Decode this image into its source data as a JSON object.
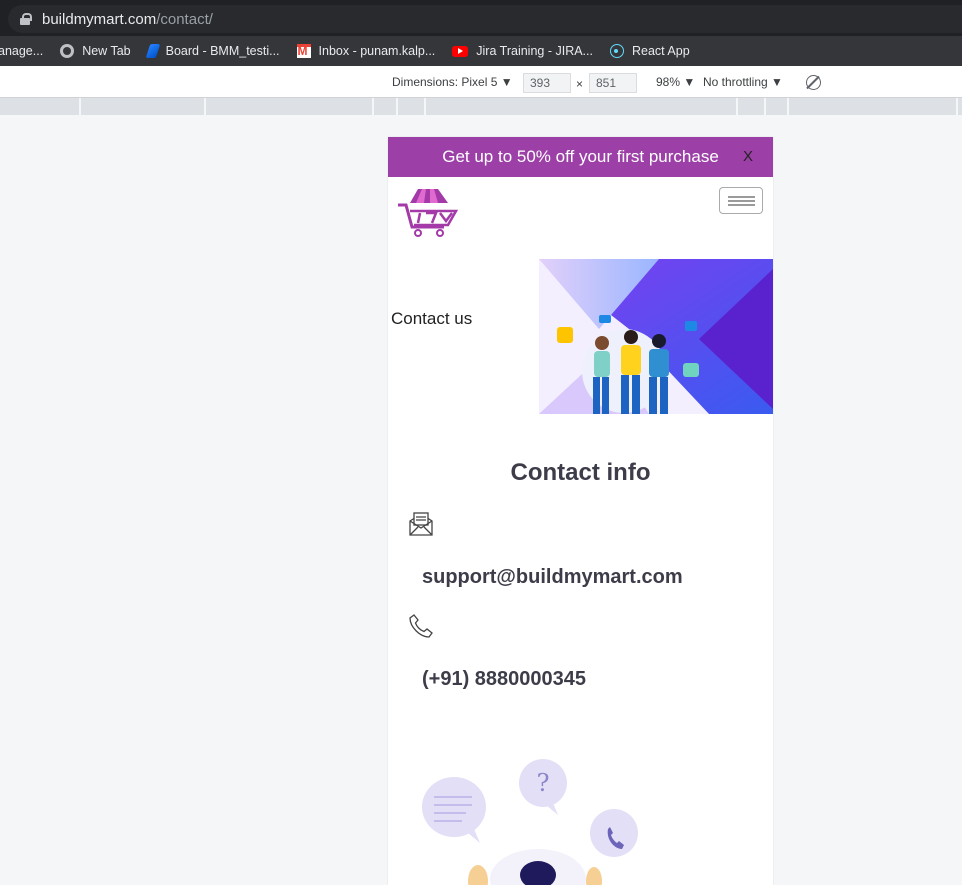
{
  "browser": {
    "url_domain": "buildmymart.com",
    "url_path": "/contact/",
    "bookmarks": [
      {
        "label": "anage...",
        "icon": "none"
      },
      {
        "label": "New Tab",
        "icon": "globe-icon"
      },
      {
        "label": "Board - BMM_testi...",
        "icon": "jira-board-icon"
      },
      {
        "label": "Inbox - punam.kalp...",
        "icon": "gmail-icon"
      },
      {
        "label": "Jira Training - JIRA...",
        "icon": "youtube-icon"
      },
      {
        "label": "React App",
        "icon": "react-icon"
      }
    ]
  },
  "devtools": {
    "dimensions_label": "Dimensions: Pixel 5 ▼",
    "width": "393",
    "times": "×",
    "height": "851",
    "zoom": "98% ▼",
    "throttling": "No throttling ▼"
  },
  "site": {
    "promo_text": "Get up to 50% off your first purchase",
    "promo_close": "X",
    "hero_title": "Contact us",
    "contact_heading": "Contact info",
    "email": "support@buildmymart.com",
    "phone": "(+91) 8880000345",
    "colors": {
      "promo": "#9c40a8",
      "heading": "#3d3d4a",
      "accent_purple": "#6a2bd1"
    }
  }
}
